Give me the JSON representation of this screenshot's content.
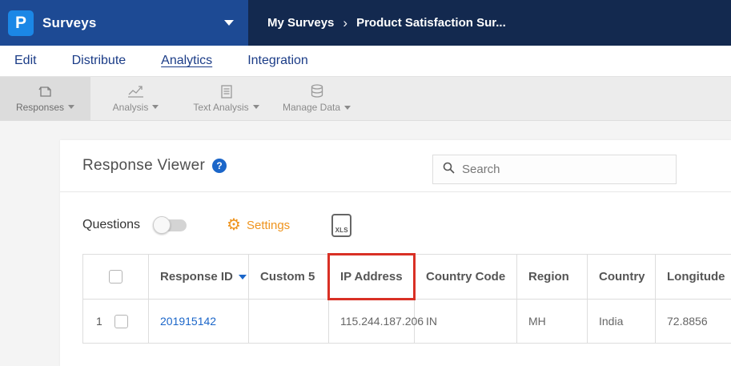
{
  "header": {
    "logo_letter": "P",
    "product_name": "Surveys",
    "breadcrumb": {
      "parent": "My Surveys",
      "separator": "›",
      "current": "Product Satisfaction Sur..."
    }
  },
  "nav_tabs": [
    {
      "label": "Edit"
    },
    {
      "label": "Distribute"
    },
    {
      "label": "Analytics",
      "active": true
    },
    {
      "label": "Integration"
    }
  ],
  "toolbar_items": [
    {
      "label": "Responses",
      "selected": true
    },
    {
      "label": "Analysis"
    },
    {
      "label": "Text Analysis"
    },
    {
      "label": "Manage Data"
    }
  ],
  "viewer": {
    "title": "Response Viewer",
    "help_glyph": "?",
    "search_placeholder": "Search",
    "questions_label": "Questions",
    "toggle_state": "off",
    "settings_label": "Settings",
    "gear_glyph": "⚙",
    "xls_icon_text": "XLS"
  },
  "table": {
    "headers": {
      "response_id": "Response ID",
      "custom5": "Custom 5",
      "ip_address": "IP Address",
      "country_code": "Country Code",
      "region": "Region",
      "country": "Country",
      "longitude": "Longitude"
    },
    "highlighted_column": "IP Address",
    "rows": [
      {
        "num": "1",
        "response_id": "201915142",
        "custom5": "",
        "ip_address": "115.244.187.206",
        "country_code": "IN",
        "region": "MH",
        "country": "India",
        "longitude": "72.8856"
      }
    ]
  },
  "colors": {
    "topbar_left": "#1d4a94",
    "topbar_right": "#13294f",
    "logo_blue": "#1b87e6",
    "link_blue": "#1b66c9",
    "nav_text": "#1b3c87",
    "settings_orange": "#ef941e",
    "highlight_red": "#d93025"
  }
}
